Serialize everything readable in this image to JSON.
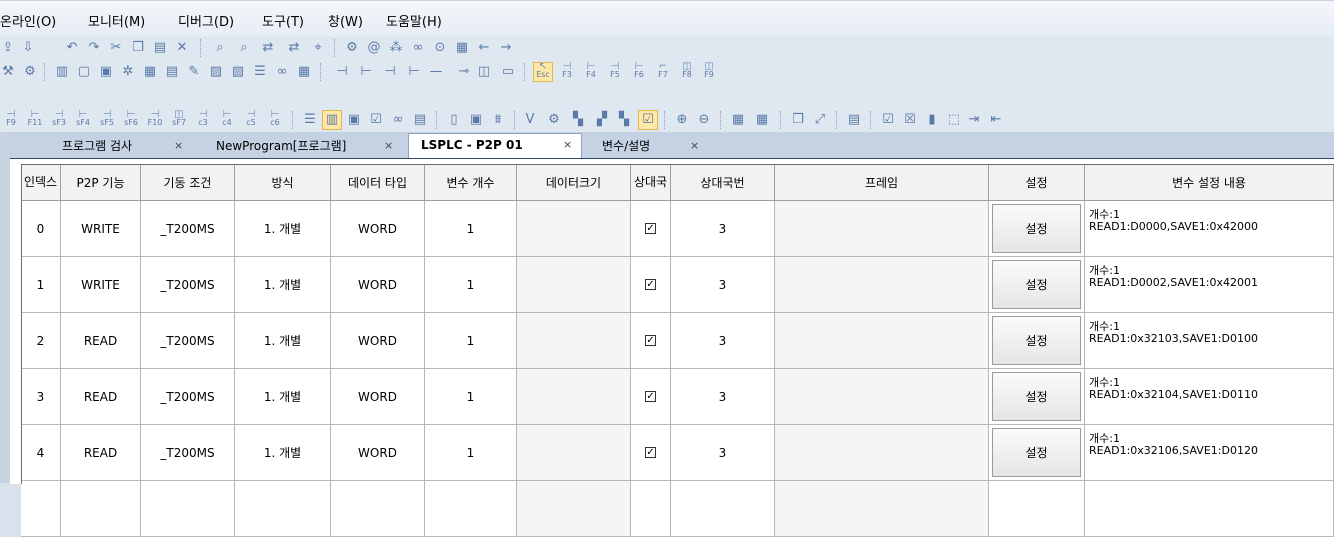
{
  "menu": [
    "온라인(O)",
    "모니터(M)",
    "디버그(D)",
    "도구(T)",
    "창(W)",
    "도움말(H)"
  ],
  "fkeys_row3": [
    "Esc",
    "F3",
    "F4",
    "F5",
    "F6",
    "F7",
    "F8",
    "F9"
  ],
  "fkeys_row4": [
    "F9",
    "F11",
    "sF3",
    "sF4",
    "sF5",
    "sF6",
    "F10",
    "sF7",
    "c3",
    "c4",
    "c5",
    "c6"
  ],
  "tabs": [
    {
      "label": "프로그램 검사",
      "close": "×"
    },
    {
      "label": "NewProgram[프로그램]",
      "close": "×"
    },
    {
      "label": "LSPLC - P2P 01",
      "close": "×"
    },
    {
      "label": "변수/설명",
      "close": "×"
    }
  ],
  "table": {
    "headers": [
      "인덱스",
      "P2P 기능",
      "기동 조건",
      "방식",
      "데이터 타입",
      "변수 개수",
      "데이터크기",
      "상대국",
      "상대국번",
      "프레임",
      "설정",
      "변수 설정 내용"
    ],
    "check_mark": "✓",
    "rows": [
      {
        "index": "0",
        "func": "WRITE",
        "cond": "_T200MS",
        "method": "1. 개별",
        "dtype": "WORD",
        "count": "1",
        "station": "3",
        "button": "설정",
        "content1": "개수:1",
        "content2": "READ1:D0000,SAVE1:0x42000"
      },
      {
        "index": "1",
        "func": "WRITE",
        "cond": "_T200MS",
        "method": "1. 개별",
        "dtype": "WORD",
        "count": "1",
        "station": "3",
        "button": "설정",
        "content1": "개수:1",
        "content2": "READ1:D0002,SAVE1:0x42001"
      },
      {
        "index": "2",
        "func": "READ",
        "cond": "_T200MS",
        "method": "1. 개별",
        "dtype": "WORD",
        "count": "1",
        "station": "3",
        "button": "설정",
        "content1": "개수:1",
        "content2": "READ1:0x32103,SAVE1:D0100"
      },
      {
        "index": "3",
        "func": "READ",
        "cond": "_T200MS",
        "method": "1. 개별",
        "dtype": "WORD",
        "count": "1",
        "station": "3",
        "button": "설정",
        "content1": "개수:1",
        "content2": "READ1:0x32104,SAVE1:D0110"
      },
      {
        "index": "4",
        "func": "READ",
        "cond": "_T200MS",
        "method": "1. 개별",
        "dtype": "WORD",
        "count": "1",
        "station": "3",
        "button": "설정",
        "content1": "개수:1",
        "content2": "READ1:0x32106,SAVE1:D0120"
      }
    ]
  }
}
